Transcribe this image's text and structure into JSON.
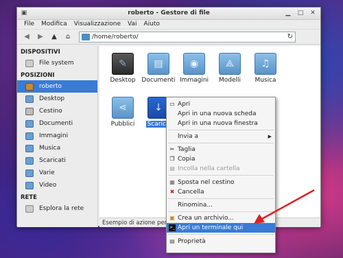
{
  "window": {
    "title": "roberto - Gestore di file"
  },
  "menubar": [
    "File",
    "Modifica",
    "Visualizzazione",
    "Vai",
    "Aiuto"
  ],
  "address": {
    "path": "/home/roberto/"
  },
  "sidebar": {
    "sections": [
      {
        "header": "DISPOSITIVI",
        "items": [
          {
            "label": "File system",
            "icon": "drive-icon"
          }
        ]
      },
      {
        "header": "POSIZIONI",
        "items": [
          {
            "label": "roberto",
            "icon": "home-icon",
            "selected": true
          },
          {
            "label": "Desktop",
            "icon": "desktop-icon"
          },
          {
            "label": "Cestino",
            "icon": "trash-icon"
          },
          {
            "label": "Documenti",
            "icon": "folder-icon"
          },
          {
            "label": "Immagini",
            "icon": "folder-icon"
          },
          {
            "label": "Musica",
            "icon": "folder-icon"
          },
          {
            "label": "Scaricati",
            "icon": "folder-icon"
          },
          {
            "label": "Varie",
            "icon": "folder-icon"
          },
          {
            "label": "Video",
            "icon": "folder-icon"
          }
        ]
      },
      {
        "header": "RETE",
        "items": [
          {
            "label": "Esplora la rete",
            "icon": "network-icon"
          }
        ]
      }
    ]
  },
  "files": [
    {
      "label": "Desktop",
      "icon": "desktop-folder-icon"
    },
    {
      "label": "Documenti",
      "icon": "documents-folder-icon"
    },
    {
      "label": "Immagini",
      "icon": "pictures-folder-icon"
    },
    {
      "label": "Modelli",
      "icon": "templates-folder-icon"
    },
    {
      "label": "Musica",
      "icon": "music-folder-icon"
    },
    {
      "label": "Pubblici",
      "icon": "public-folder-icon"
    },
    {
      "label": "Scarica",
      "icon": "downloads-folder-icon",
      "selected": true
    }
  ],
  "statusbar": {
    "text": "Esempio di azione per"
  },
  "context_menu": [
    {
      "label": "Apri",
      "icon": "open-icon"
    },
    {
      "label": "Apri in una nuova scheda"
    },
    {
      "label": "Apri in una nuova finestra"
    },
    {
      "label": "Invia a",
      "submenu": true
    },
    {
      "label": "Taglia",
      "icon": "cut-icon"
    },
    {
      "label": "Copia",
      "icon": "copy-icon"
    },
    {
      "label": "Incolla nella cartella",
      "icon": "paste-icon",
      "disabled": true
    },
    {
      "label": "Sposta nel cestino",
      "icon": "trash-icon"
    },
    {
      "label": "Cancella",
      "icon": "delete-icon"
    },
    {
      "label": "Rinomina..."
    },
    {
      "label": "Crea un archivio...",
      "icon": "archive-icon"
    },
    {
      "label": "Apri un terminale qui",
      "icon": "terminal-icon",
      "highlighted": true
    },
    {
      "label": "Proprietà",
      "icon": "properties-icon"
    }
  ],
  "colors": {
    "selection": "#3a7bd5",
    "annotation_arrow": "#e02020"
  }
}
